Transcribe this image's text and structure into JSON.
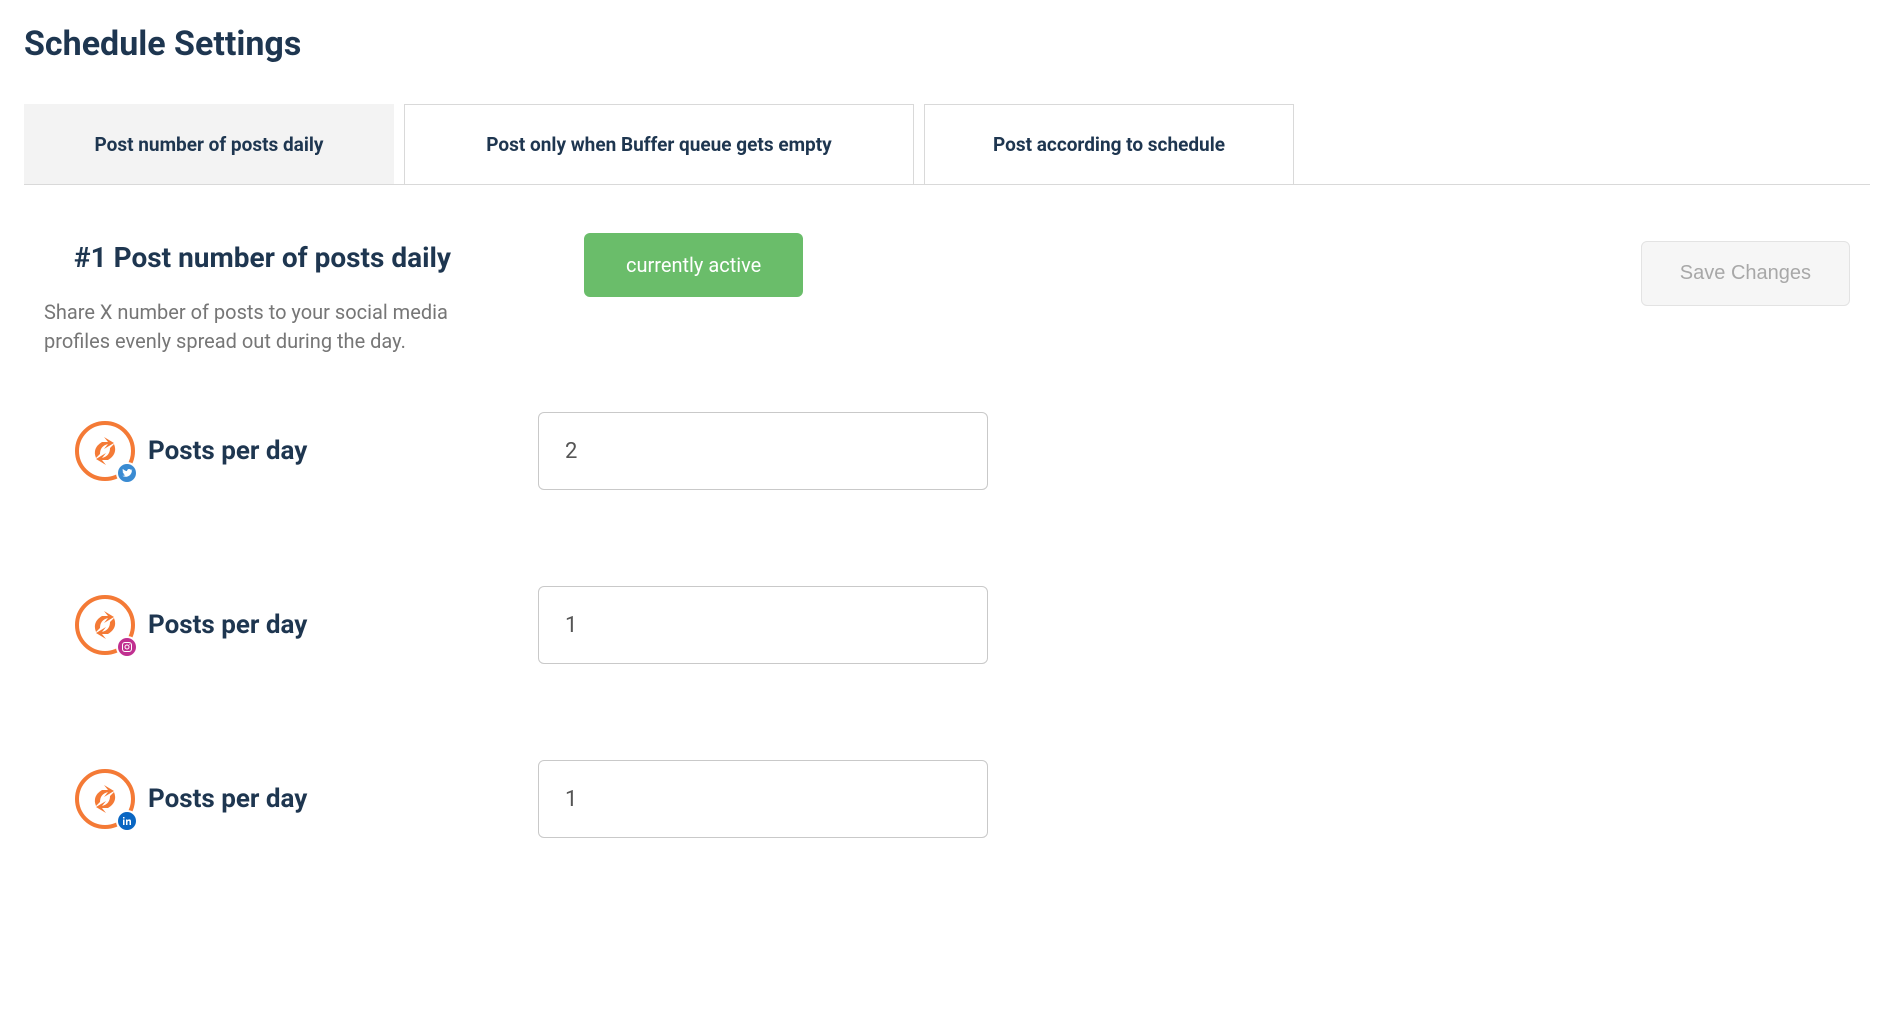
{
  "page_title": "Schedule Settings",
  "tabs": [
    {
      "label": "Post number of posts daily",
      "active": true
    },
    {
      "label": "Post only when Buffer queue gets empty",
      "active": false
    },
    {
      "label": "Post according to schedule",
      "active": false
    }
  ],
  "section": {
    "title": "#1 Post number of posts daily",
    "description": "Share X number of posts to your social media profiles evenly spread out during the day.",
    "status_label": "currently active",
    "save_button_label": "Save Changes"
  },
  "rows": [
    {
      "label": "Posts per day",
      "value": "2",
      "network": "twitter",
      "badge_color": "#3a8bd2"
    },
    {
      "label": "Posts per day",
      "value": "1",
      "network": "instagram",
      "badge_color": "#c03090"
    },
    {
      "label": "Posts per day",
      "value": "1",
      "network": "linkedin",
      "badge_color": "#0a66c2"
    }
  ]
}
